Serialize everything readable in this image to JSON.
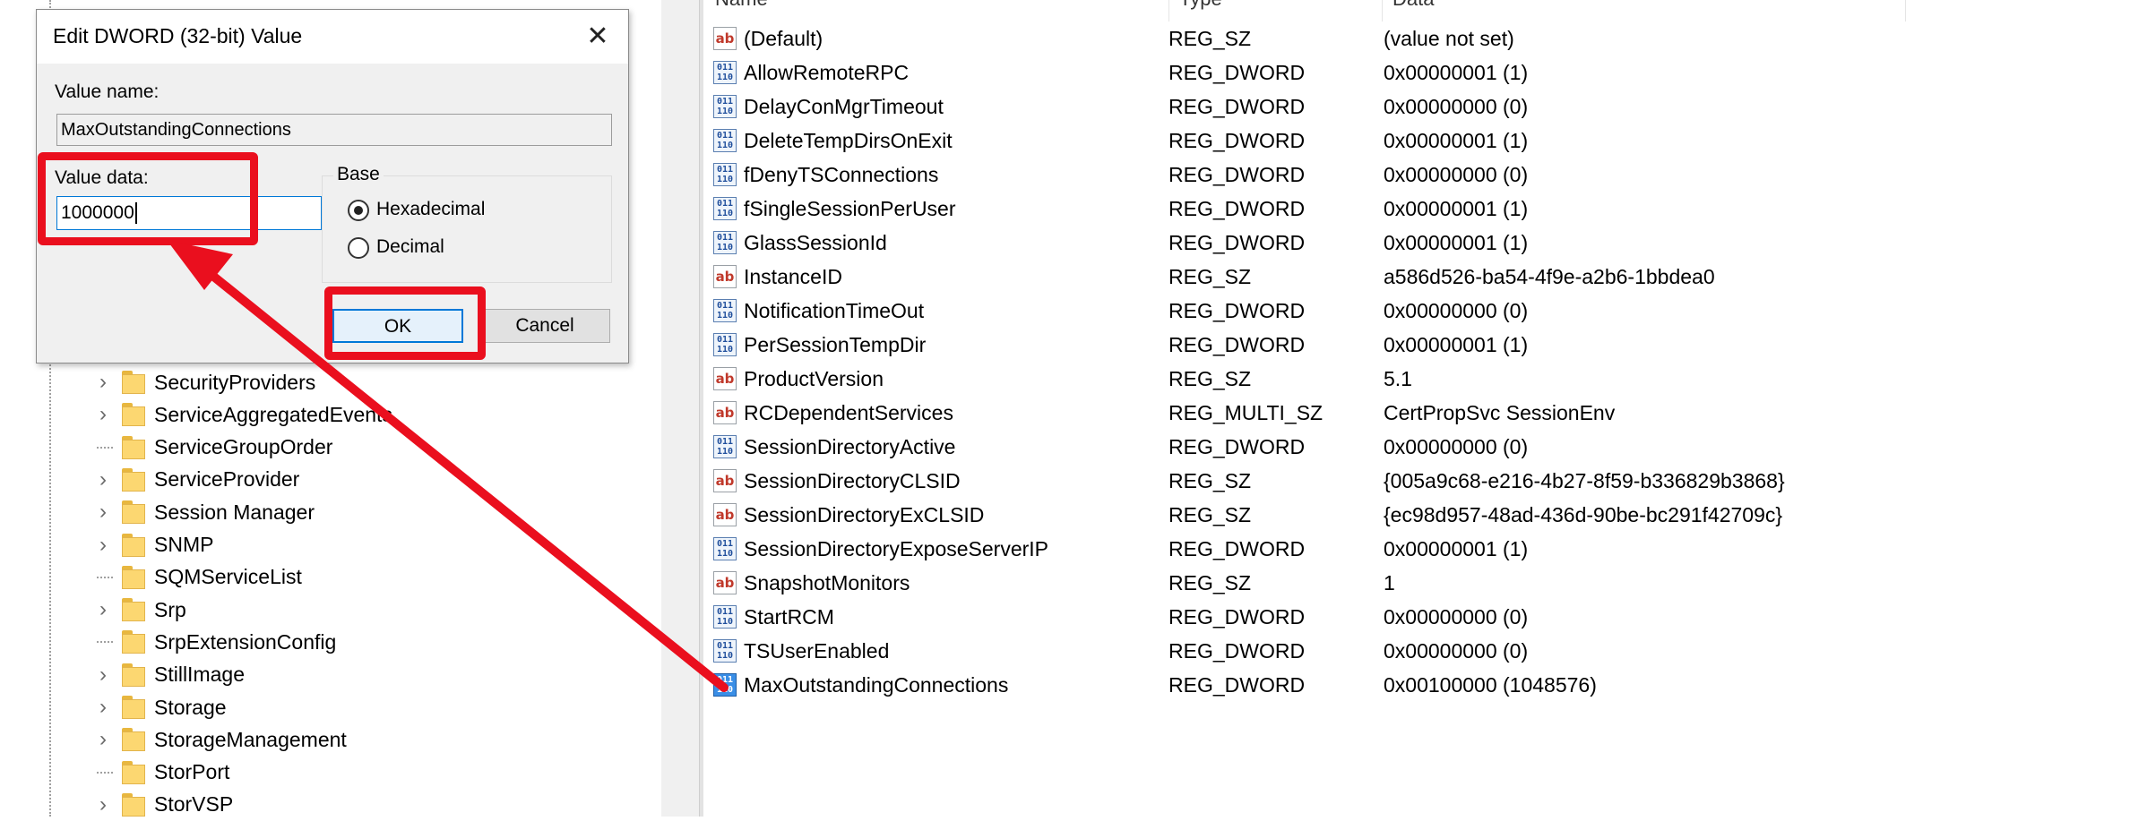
{
  "tree": {
    "items": [
      {
        "label": "SecurityProviders",
        "expandable": true
      },
      {
        "label": "ServiceAggregatedEvents",
        "expandable": true
      },
      {
        "label": "ServiceGroupOrder",
        "expandable": false
      },
      {
        "label": "ServiceProvider",
        "expandable": true
      },
      {
        "label": "Session Manager",
        "expandable": true
      },
      {
        "label": "SNMP",
        "expandable": true
      },
      {
        "label": "SQMServiceList",
        "expandable": false
      },
      {
        "label": "Srp",
        "expandable": true
      },
      {
        "label": "SrpExtensionConfig",
        "expandable": false
      },
      {
        "label": "StillImage",
        "expandable": true
      },
      {
        "label": "Storage",
        "expandable": true
      },
      {
        "label": "StorageManagement",
        "expandable": true
      },
      {
        "label": "StorPort",
        "expandable": false
      },
      {
        "label": "StorVSP",
        "expandable": true
      }
    ]
  },
  "list": {
    "columns": {
      "name": "Name",
      "type": "Type",
      "data": "Data"
    },
    "rows": [
      {
        "name": "(Default)",
        "type": "REG_SZ",
        "data": "(value not set)",
        "icon": "string-value-icon"
      },
      {
        "name": "AllowRemoteRPC",
        "type": "REG_DWORD",
        "data": "0x00000001 (1)",
        "icon": "dword-value-icon"
      },
      {
        "name": "DelayConMgrTimeout",
        "type": "REG_DWORD",
        "data": "0x00000000 (0)",
        "icon": "dword-value-icon"
      },
      {
        "name": "DeleteTempDirsOnExit",
        "type": "REG_DWORD",
        "data": "0x00000001 (1)",
        "icon": "dword-value-icon"
      },
      {
        "name": "fDenyTSConnections",
        "type": "REG_DWORD",
        "data": "0x00000000 (0)",
        "icon": "dword-value-icon"
      },
      {
        "name": "fSingleSessionPerUser",
        "type": "REG_DWORD",
        "data": "0x00000001 (1)",
        "icon": "dword-value-icon"
      },
      {
        "name": "GlassSessionId",
        "type": "REG_DWORD",
        "data": "0x00000001 (1)",
        "icon": "dword-value-icon"
      },
      {
        "name": "InstanceID",
        "type": "REG_SZ",
        "data": "a586d526-ba54-4f9e-a2b6-1bbdea0",
        "icon": "string-value-icon"
      },
      {
        "name": "NotificationTimeOut",
        "type": "REG_DWORD",
        "data": "0x00000000 (0)",
        "icon": "dword-value-icon"
      },
      {
        "name": "PerSessionTempDir",
        "type": "REG_DWORD",
        "data": "0x00000001 (1)",
        "icon": "dword-value-icon"
      },
      {
        "name": "ProductVersion",
        "type": "REG_SZ",
        "data": "5.1",
        "icon": "string-value-icon"
      },
      {
        "name": "RCDependentServices",
        "type": "REG_MULTI_SZ",
        "data": "CertPropSvc SessionEnv",
        "icon": "string-value-icon"
      },
      {
        "name": "SessionDirectoryActive",
        "type": "REG_DWORD",
        "data": "0x00000000 (0)",
        "icon": "dword-value-icon"
      },
      {
        "name": "SessionDirectoryCLSID",
        "type": "REG_SZ",
        "data": "{005a9c68-e216-4b27-8f59-b336829b3868}",
        "icon": "string-value-icon"
      },
      {
        "name": "SessionDirectoryExCLSID",
        "type": "REG_SZ",
        "data": "{ec98d957-48ad-436d-90be-bc291f42709c}",
        "icon": "string-value-icon"
      },
      {
        "name": "SessionDirectoryExposeServerIP",
        "type": "REG_DWORD",
        "data": "0x00000001 (1)",
        "icon": "dword-value-icon"
      },
      {
        "name": "SnapshotMonitors",
        "type": "REG_SZ",
        "data": "1",
        "icon": "string-value-icon"
      },
      {
        "name": "StartRCM",
        "type": "REG_DWORD",
        "data": "0x00000000 (0)",
        "icon": "dword-value-icon"
      },
      {
        "name": "TSUserEnabled",
        "type": "REG_DWORD",
        "data": "0x00000000 (0)",
        "icon": "dword-value-icon"
      },
      {
        "name": "MaxOutstandingConnections",
        "type": "REG_DWORD",
        "data": "0x00100000 (1048576)",
        "icon": "dword-value-icon",
        "selected": true
      }
    ]
  },
  "dialog": {
    "title": "Edit DWORD (32-bit) Value",
    "value_name_label": "Value name:",
    "value_name": "MaxOutstandingConnections",
    "value_data_label": "Value data:",
    "value_data": "1000000",
    "base_label": "Base",
    "radio_hex": "Hexadecimal",
    "radio_dec": "Decimal",
    "selected_base": "Hexadecimal",
    "ok_label": "OK",
    "cancel_label": "Cancel",
    "close_glyph": "✕"
  },
  "string_icon_text": "ab",
  "dword_icon_text": "011 110",
  "colors": {
    "annotation": "#ea0f1e",
    "accent": "#0078d7"
  }
}
